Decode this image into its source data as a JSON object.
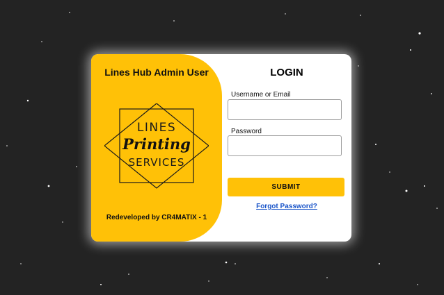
{
  "page": {
    "background_color": "#232323",
    "accent_color": "#ffc107",
    "link_color": "#1a55c9"
  },
  "brand_panel": {
    "title": "Lines Hub Admin User",
    "logo": {
      "line1": "LINES",
      "line2": "Printing",
      "line3": "SERVICES"
    },
    "credit": "Redeveloped by CR4MATIX - 1"
  },
  "login_form": {
    "title": "LOGIN",
    "username": {
      "label": "Username or Email",
      "value": "",
      "placeholder": ""
    },
    "password": {
      "label": "Password",
      "value": "",
      "placeholder": ""
    },
    "submit_label": "SUBMIT",
    "forgot_label": "Forgot Password?"
  }
}
